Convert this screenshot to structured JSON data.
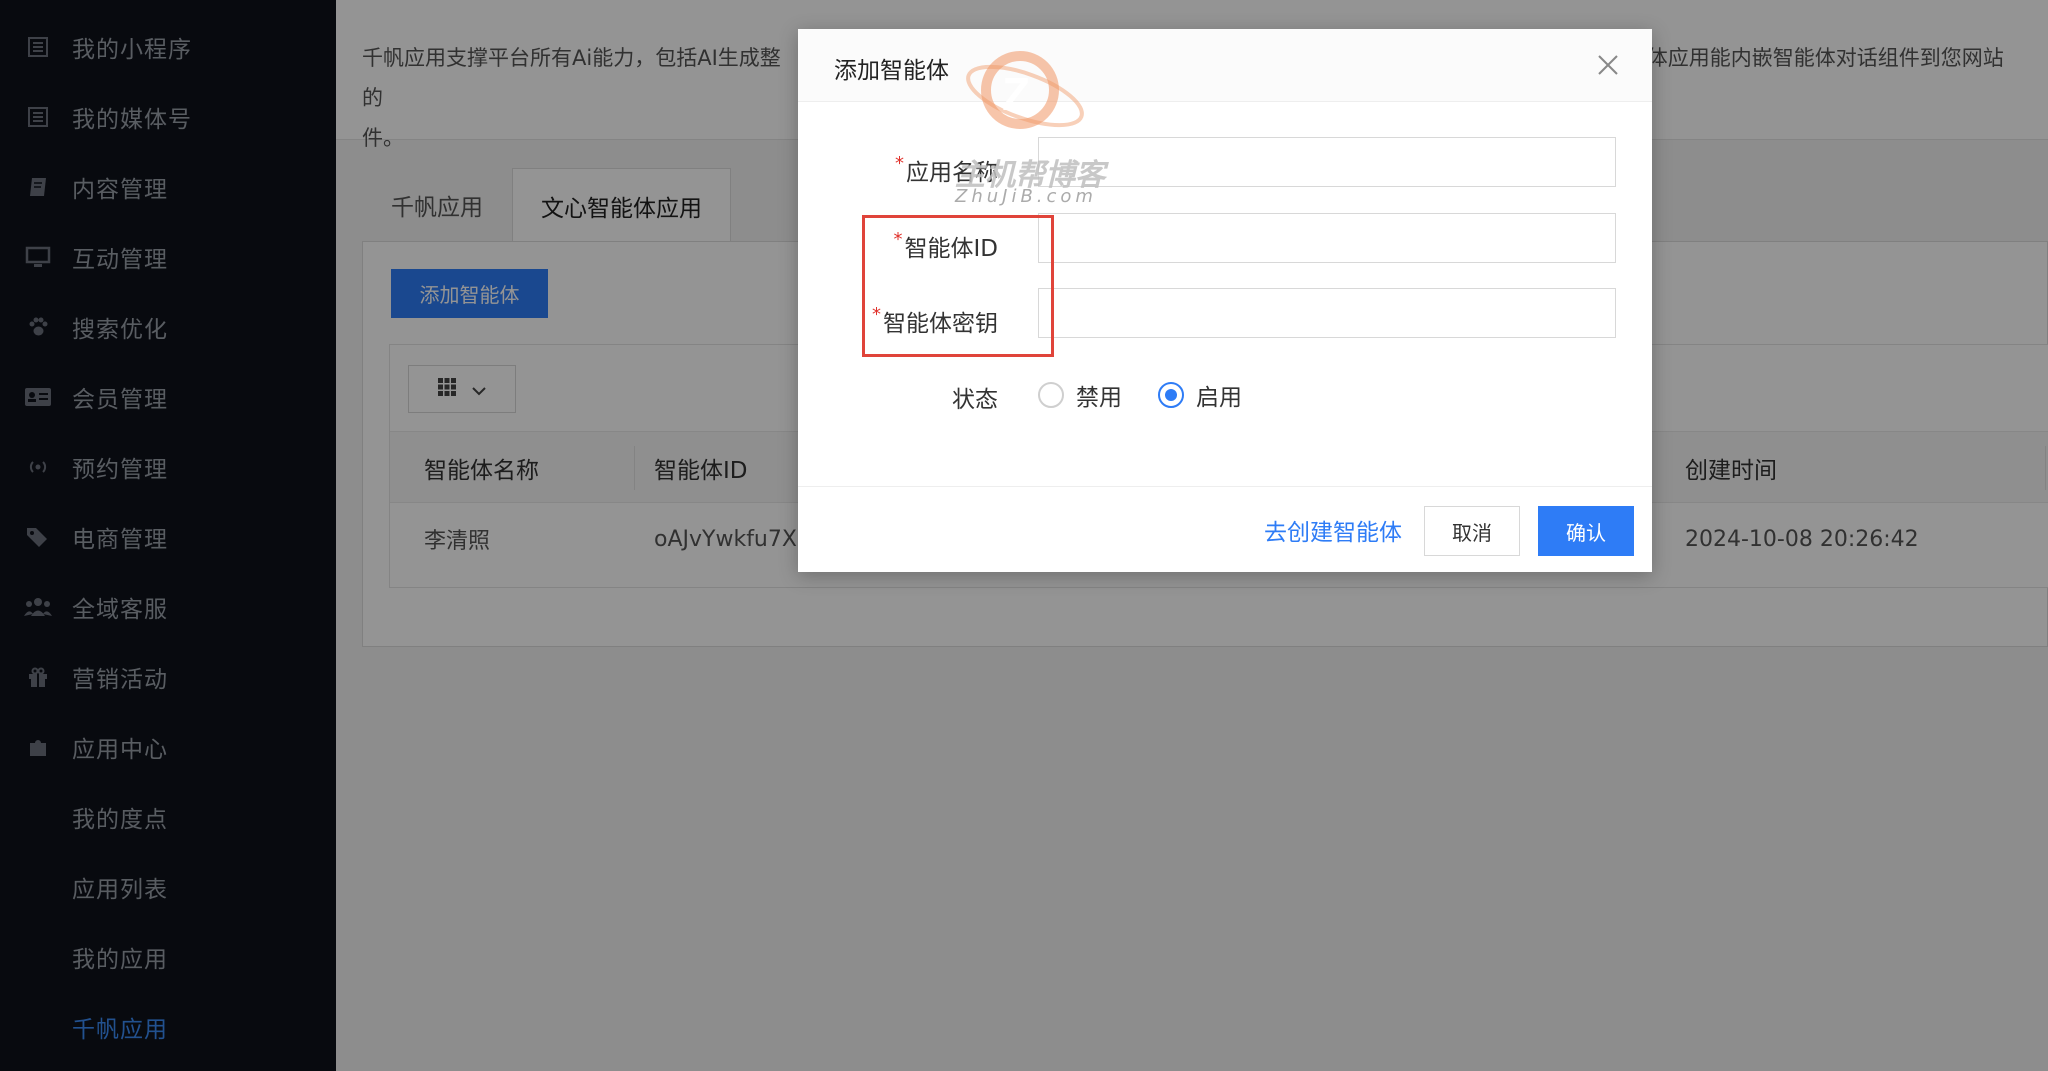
{
  "sidebar": {
    "items": [
      {
        "label": "我的小程序",
        "icon": "list-icon"
      },
      {
        "label": "我的媒体号",
        "icon": "list-icon"
      },
      {
        "label": "内容管理",
        "icon": "book-icon"
      },
      {
        "label": "互动管理",
        "icon": "monitor-icon"
      },
      {
        "label": "搜索优化",
        "icon": "paw-icon"
      },
      {
        "label": "会员管理",
        "icon": "id-card-icon"
      },
      {
        "label": "预约管理",
        "icon": "signal-icon"
      },
      {
        "label": "电商管理",
        "icon": "tags-icon"
      },
      {
        "label": "全域客服",
        "icon": "users-icon"
      },
      {
        "label": "营销活动",
        "icon": "gift-icon"
      },
      {
        "label": "应用中心",
        "icon": "puzzle-icon"
      },
      {
        "label": "我的度点",
        "icon": ""
      },
      {
        "label": "应用列表",
        "icon": ""
      },
      {
        "label": "我的应用",
        "icon": ""
      },
      {
        "label": "千帆应用",
        "icon": "",
        "active": true
      }
    ]
  },
  "main": {
    "description_left": "千帆应用支撑平台所有Ai能力，包括AI生成整",
    "description_right": "体应用能内嵌智能体对话组件到您网站的",
    "description_tail": "件。",
    "tabs": [
      {
        "label": "千帆应用"
      },
      {
        "label": "文心智能体应用",
        "active": true
      }
    ],
    "add_button": "添加智能体",
    "table": {
      "columns": [
        "智能体名称",
        "智能体ID",
        "创建时间"
      ],
      "rows": [
        {
          "name": "李清照",
          "id": "oAJvYwkfu7X",
          "created": "2024-10-08 20:26:42"
        }
      ]
    }
  },
  "modal": {
    "title": "添加智能体",
    "fields": [
      {
        "label": "应用名称",
        "required": true,
        "value": ""
      },
      {
        "label": "智能体ID",
        "required": true,
        "value": ""
      },
      {
        "label": "智能体密钥",
        "required": true,
        "value": ""
      }
    ],
    "status_label": "状态",
    "status_options": [
      "禁用",
      "启用"
    ],
    "status_selected": "启用",
    "create_link": "去创建智能体",
    "cancel": "取消",
    "confirm": "确认"
  },
  "watermark": {
    "text": "主机帮博客",
    "sub": "ZhuJiB.com"
  },
  "colors": {
    "accent": "#2e7cf6",
    "sidebar_bg": "#0f121b",
    "highlight": "#e0443a",
    "required": "#e0312b"
  }
}
